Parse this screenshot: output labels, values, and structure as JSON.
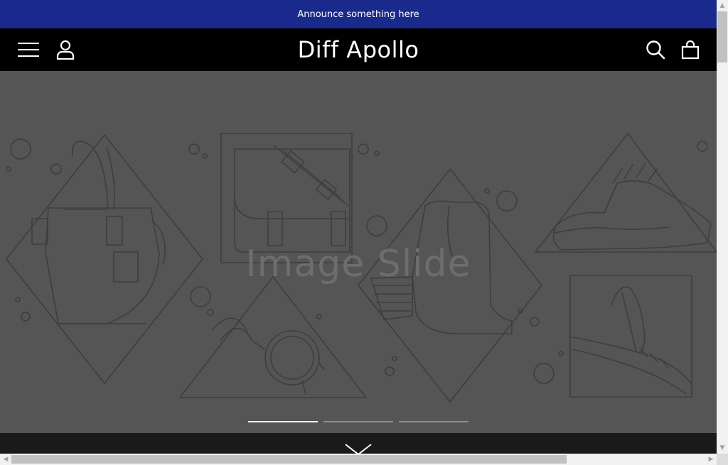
{
  "announcement": {
    "text": "Announce something here",
    "color": "#1a2a8c"
  },
  "header": {
    "logo": "Diff Apollo",
    "menu_icon": "hamburger-menu-icon",
    "account_icon": "user-icon",
    "search_icon": "search-icon",
    "cart_icon": "shopping-bag-icon"
  },
  "hero": {
    "label": "Image Slide",
    "slides_count": 3,
    "active_slide": 1
  },
  "scroll_down_icon": "chevron-down-icon"
}
